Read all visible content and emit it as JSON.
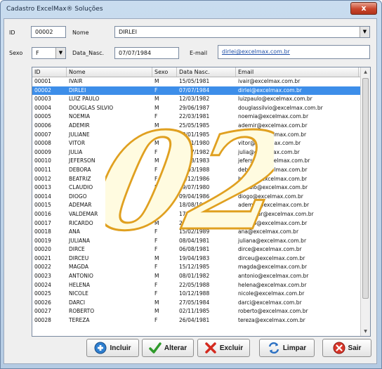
{
  "window": {
    "title": "Cadastro ExcelMax® Soluções",
    "close_label": "x"
  },
  "form": {
    "id_label": "ID",
    "id_value": "00002",
    "nome_label": "Nome",
    "nome_value": "DIRLEI",
    "sexo_label": "Sexo",
    "sexo_value": "F",
    "data_label": "Data_Nasc.",
    "data_value": "07/07/1984",
    "email_label": "E-mail",
    "email_value": "dirlei@excelmax.com.br"
  },
  "grid": {
    "columns": [
      "ID",
      "Nome",
      "Sexo",
      "Data Nasc.",
      "Email"
    ],
    "selected_index": 1,
    "rows": [
      [
        "00001",
        "IVAIR",
        "M",
        "15/05/1981",
        "ivair@excelmax.com.br"
      ],
      [
        "00002",
        "DIRLEI",
        "F",
        "07/07/1984",
        "dirlei@excelmax.com.br"
      ],
      [
        "00003",
        "LUIZ PAULO",
        "M",
        "12/03/1982",
        "luizpaulo@excelmax.com.br"
      ],
      [
        "00004",
        "DOUGLAS SILVIO",
        "M",
        "29/06/1987",
        "douglassilvio@excelmax.com.br"
      ],
      [
        "00005",
        "NOEMIA",
        "F",
        "22/03/1981",
        "noemia@excelmax.com.br"
      ],
      [
        "00006",
        "ADEMIR",
        "M",
        "25/05/1985",
        "ademir@excelmax.com.br"
      ],
      [
        "00007",
        "JULIANE",
        "F",
        "30/01/1985",
        "juliane@excelmax.com.br"
      ],
      [
        "00008",
        "VITOR",
        "M",
        "16/11/1980",
        "vitor@excelmax.com.br"
      ],
      [
        "00009",
        "JULIA",
        "F",
        "20/07/1982",
        "julia@excelmax.com.br"
      ],
      [
        "00010",
        "JEFERSON",
        "M",
        "31/03/1983",
        "jeferson@excelmax.com.br"
      ],
      [
        "00011",
        "DEBORA",
        "F",
        "20/03/1988",
        "debora@excelmax.com.br"
      ],
      [
        "00012",
        "BEATRIZ",
        "F",
        "30/12/1986",
        "beatriz@excelmax.com.br"
      ],
      [
        "00013",
        "CLAUDIO",
        "M",
        "29/07/1980",
        "claudio@excelmax.com.br"
      ],
      [
        "00014",
        "DIOGO",
        "M",
        "09/04/1986",
        "diogo@excelmax.com.br"
      ],
      [
        "00015",
        "ADEMAR",
        "M",
        "18/08/1988",
        "ademar@excelmax.com.br"
      ],
      [
        "00016",
        "VALDEMAR",
        "M",
        "17/10/1988",
        "valdemar@excelmax.com.br"
      ],
      [
        "00017",
        "RICARDO",
        "M",
        "25/05/1984",
        "ricardo@excelmax.com.br"
      ],
      [
        "00018",
        "ANA",
        "F",
        "15/02/1989",
        "ana@excelmax.com.br"
      ],
      [
        "00019",
        "JULIANA",
        "F",
        "08/04/1981",
        "juliana@excelmax.com.br"
      ],
      [
        "00020",
        "DIRCE",
        "F",
        "06/08/1981",
        "dirce@excelmax.com.br"
      ],
      [
        "00021",
        "DIRCEU",
        "M",
        "19/04/1983",
        "dirceu@excelmax.com.br"
      ],
      [
        "00022",
        "MAGDA",
        "F",
        "15/12/1985",
        "magda@excelmax.com.br"
      ],
      [
        "00023",
        "ANTONIO",
        "M",
        "08/01/1982",
        "antonio@excelmax.com.br"
      ],
      [
        "00024",
        "HELENA",
        "F",
        "22/05/1988",
        "helena@excelmax.com.br"
      ],
      [
        "00025",
        "NICOLE",
        "F",
        "10/12/1988",
        "nicole@excelmax.com.br"
      ],
      [
        "00026",
        "DARCI",
        "M",
        "27/05/1984",
        "darci@excelmax.com.br"
      ],
      [
        "00027",
        "ROBERTO",
        "M",
        "02/11/1985",
        "roberto@excelmax.com.br"
      ],
      [
        "00028",
        "TEREZA",
        "F",
        "26/04/1981",
        "tereza@excelmax.com.br"
      ]
    ]
  },
  "buttons": {
    "incluir": "Incluir",
    "alterar": "Alterar",
    "excluir": "Excluir",
    "limpar": "Limpar",
    "sair": "Sair"
  },
  "watermark": {
    "text": "02",
    "fill_color": "#fffbe0",
    "stroke_color": "#e0a020"
  },
  "colors": {
    "selection": "#3d8ee9",
    "email_link": "#1f4fa8"
  }
}
